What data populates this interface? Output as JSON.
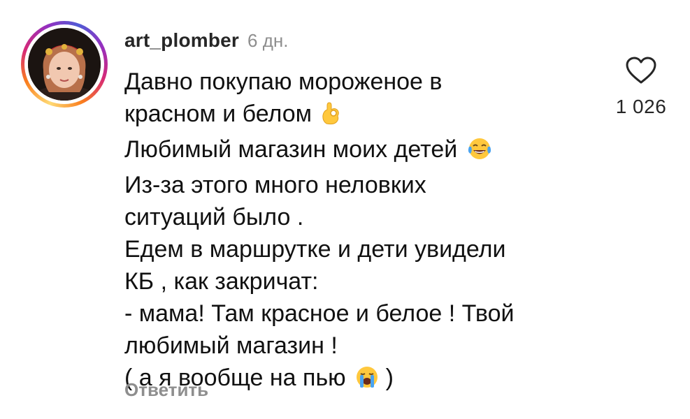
{
  "comment": {
    "username": "art_plomber",
    "time_ago": "6 дн.",
    "lines": [
      "Давно покупаю мороженое в",
      "красном и белом",
      "Любимый магазин моих детей",
      "Из-за этого много неловких",
      "ситуаций было .",
      "Едем в маршрутке и дети увидели",
      "КБ , как закричат:",
      "- мама! Там красное и белое ! Твой",
      "любимый магазин !",
      "( а я вообще на пью",
      ")"
    ],
    "emojis": {
      "line_2": "ok-hand-icon",
      "line_3": "tears-of-joy-icon",
      "line_10": "loudly-crying-icon"
    },
    "reply_label": "Ответить"
  },
  "likes": {
    "count": "1 026",
    "icon": "heart-outline-icon"
  },
  "colors": {
    "text": "#111111",
    "muted": "#8e8e8e",
    "username": "#262626",
    "emoji_yellow": "#ffc83d",
    "tear_blue": "#4aa3f0"
  }
}
